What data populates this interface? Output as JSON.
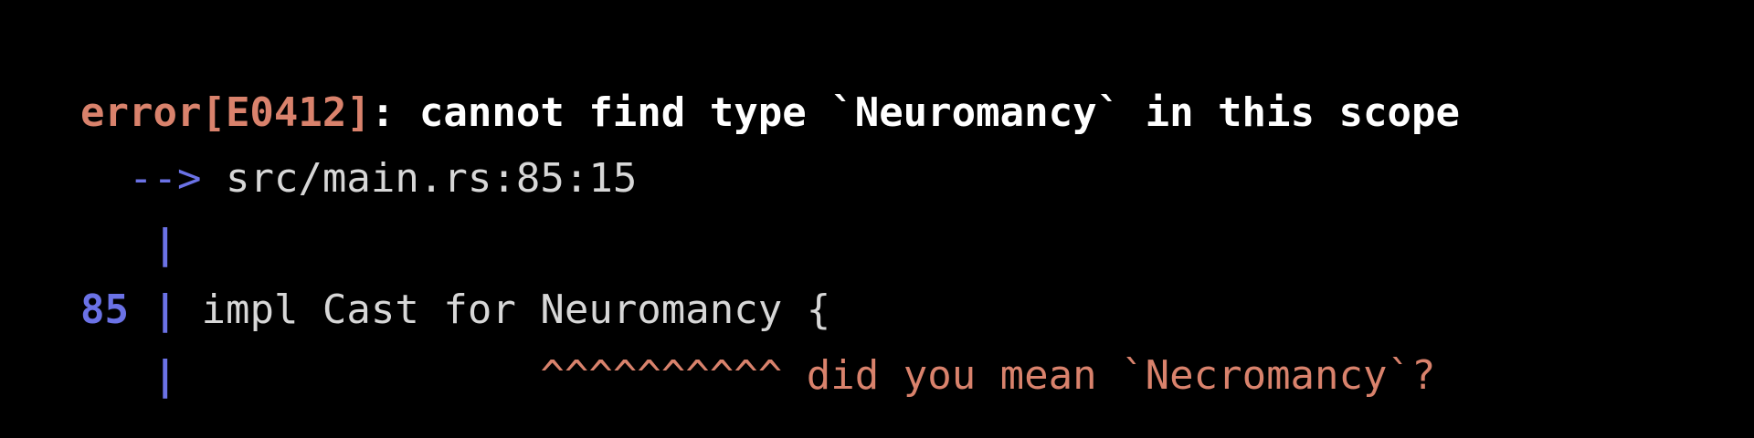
{
  "error": {
    "label": "error[E0412]",
    "separator": ":",
    "message": " cannot find type `Neuromancy` in this scope"
  },
  "location": {
    "arrow": "-->",
    "path": "src/main.rs:85:15"
  },
  "gutter": {
    "pipe": "|",
    "line_number": "85"
  },
  "code_line": {
    "text": "impl Cast for Neuromancy {"
  },
  "annotation": {
    "carets": "^^^^^^^^^^",
    "hint": "did you mean `Necromancy`?"
  },
  "colors": {
    "error": "#d9826c",
    "gutter": "#6b72e6",
    "text": "#d7d7d7",
    "background": "#000000"
  }
}
